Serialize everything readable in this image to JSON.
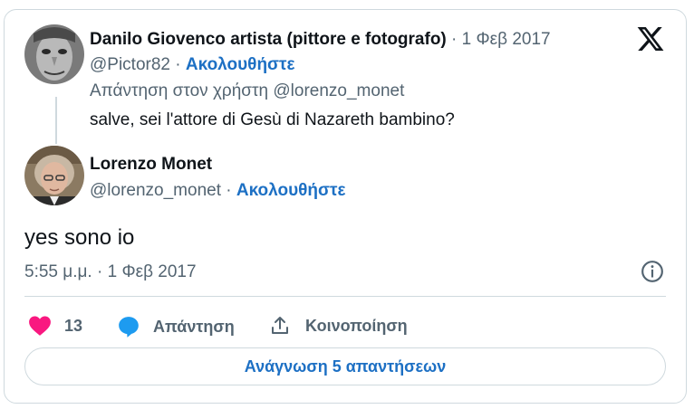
{
  "parent": {
    "author_name": "Danilo Giovenco artista (pittore e fotografo)",
    "separator": "·",
    "date": "1 Φεβ 2017",
    "handle": "@Pictor82",
    "follow_label": "Ακολουθήστε",
    "reply_to": "Απάντηση στον χρήστη @lorenzo_monet",
    "text": "salve, sei l'attore di Gesù di Nazareth bambino?"
  },
  "reply": {
    "author_name": "Lorenzo Monet",
    "handle": "@lorenzo_monet",
    "separator": "·",
    "follow_label": "Ακολουθήστε",
    "text": "yes sono io",
    "timestamp": "5:55 μ.μ. · 1 Φεβ 2017"
  },
  "actions": {
    "like_count": "13",
    "reply_label": "Απάντηση",
    "share_label": "Κοινοποίηση"
  },
  "read_replies_label": "Ανάγνωση 5 απαντήσεων",
  "icons": {
    "logo": "x-logo-icon",
    "info": "info-icon",
    "like": "heart-icon",
    "reply": "speech-bubble-icon",
    "share": "share-icon"
  },
  "colors": {
    "accent": "#1d70c4",
    "like": "#f91880",
    "reply": "#1d9bf0",
    "muted": "#536471"
  }
}
